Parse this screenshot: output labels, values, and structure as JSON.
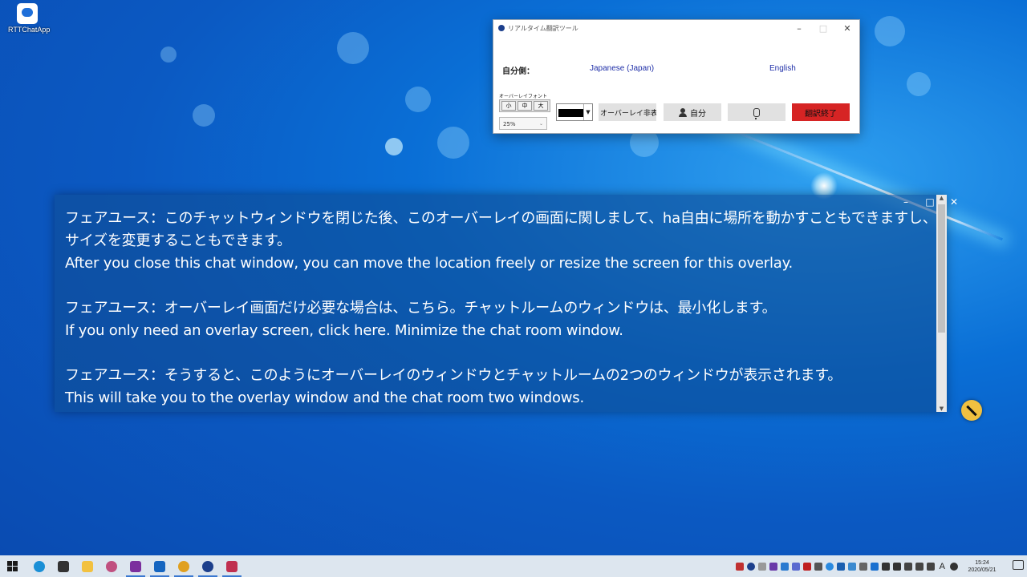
{
  "desktop": {
    "icon_label": "RTTChatApp"
  },
  "translator": {
    "title": "リアルタイム翻訳ツール",
    "self_label": "自分側：",
    "source_lang": "Japanese (Japan)",
    "target_lang": "English",
    "font_caption": "オーバーレイフォント",
    "font_sizes": [
      "小",
      "中",
      "大"
    ],
    "opacity_value": "25%",
    "color_value": "#000000",
    "hide_overlay_label": "オーバーレイ非表示",
    "self_button_label": "自分",
    "end_button_label": "翻訳終了",
    "end_color": "#d62424"
  },
  "overlay": {
    "messages": [
      {
        "ja": "フェアユース：このチャットウィンドウを閉じた後、このオーバーレイの画面に関しまして、ha自由に場所を動かすこともできますし、サイズを変更することもできます。",
        "en": "After you close this chat window, you can move the location freely or resize the screen for this overlay."
      },
      {
        "ja": "フェアユース：オーバーレイ画面だけ必要な場合は、こちら。チャットルームのウィンドウは、最小化します。",
        "en": "If you only need an overlay screen, click here. Minimize the chat room window."
      },
      {
        "ja": "フェアユース：そうすると、このようにオーバーレイのウィンドウとチャットルームの2つのウィンドウが表示されます。",
        "en": "This will take you to the overlay window and the chat room two windows."
      }
    ]
  },
  "taskbar": {
    "time": "15:24",
    "date": "2020/05/21",
    "ime": "A"
  }
}
